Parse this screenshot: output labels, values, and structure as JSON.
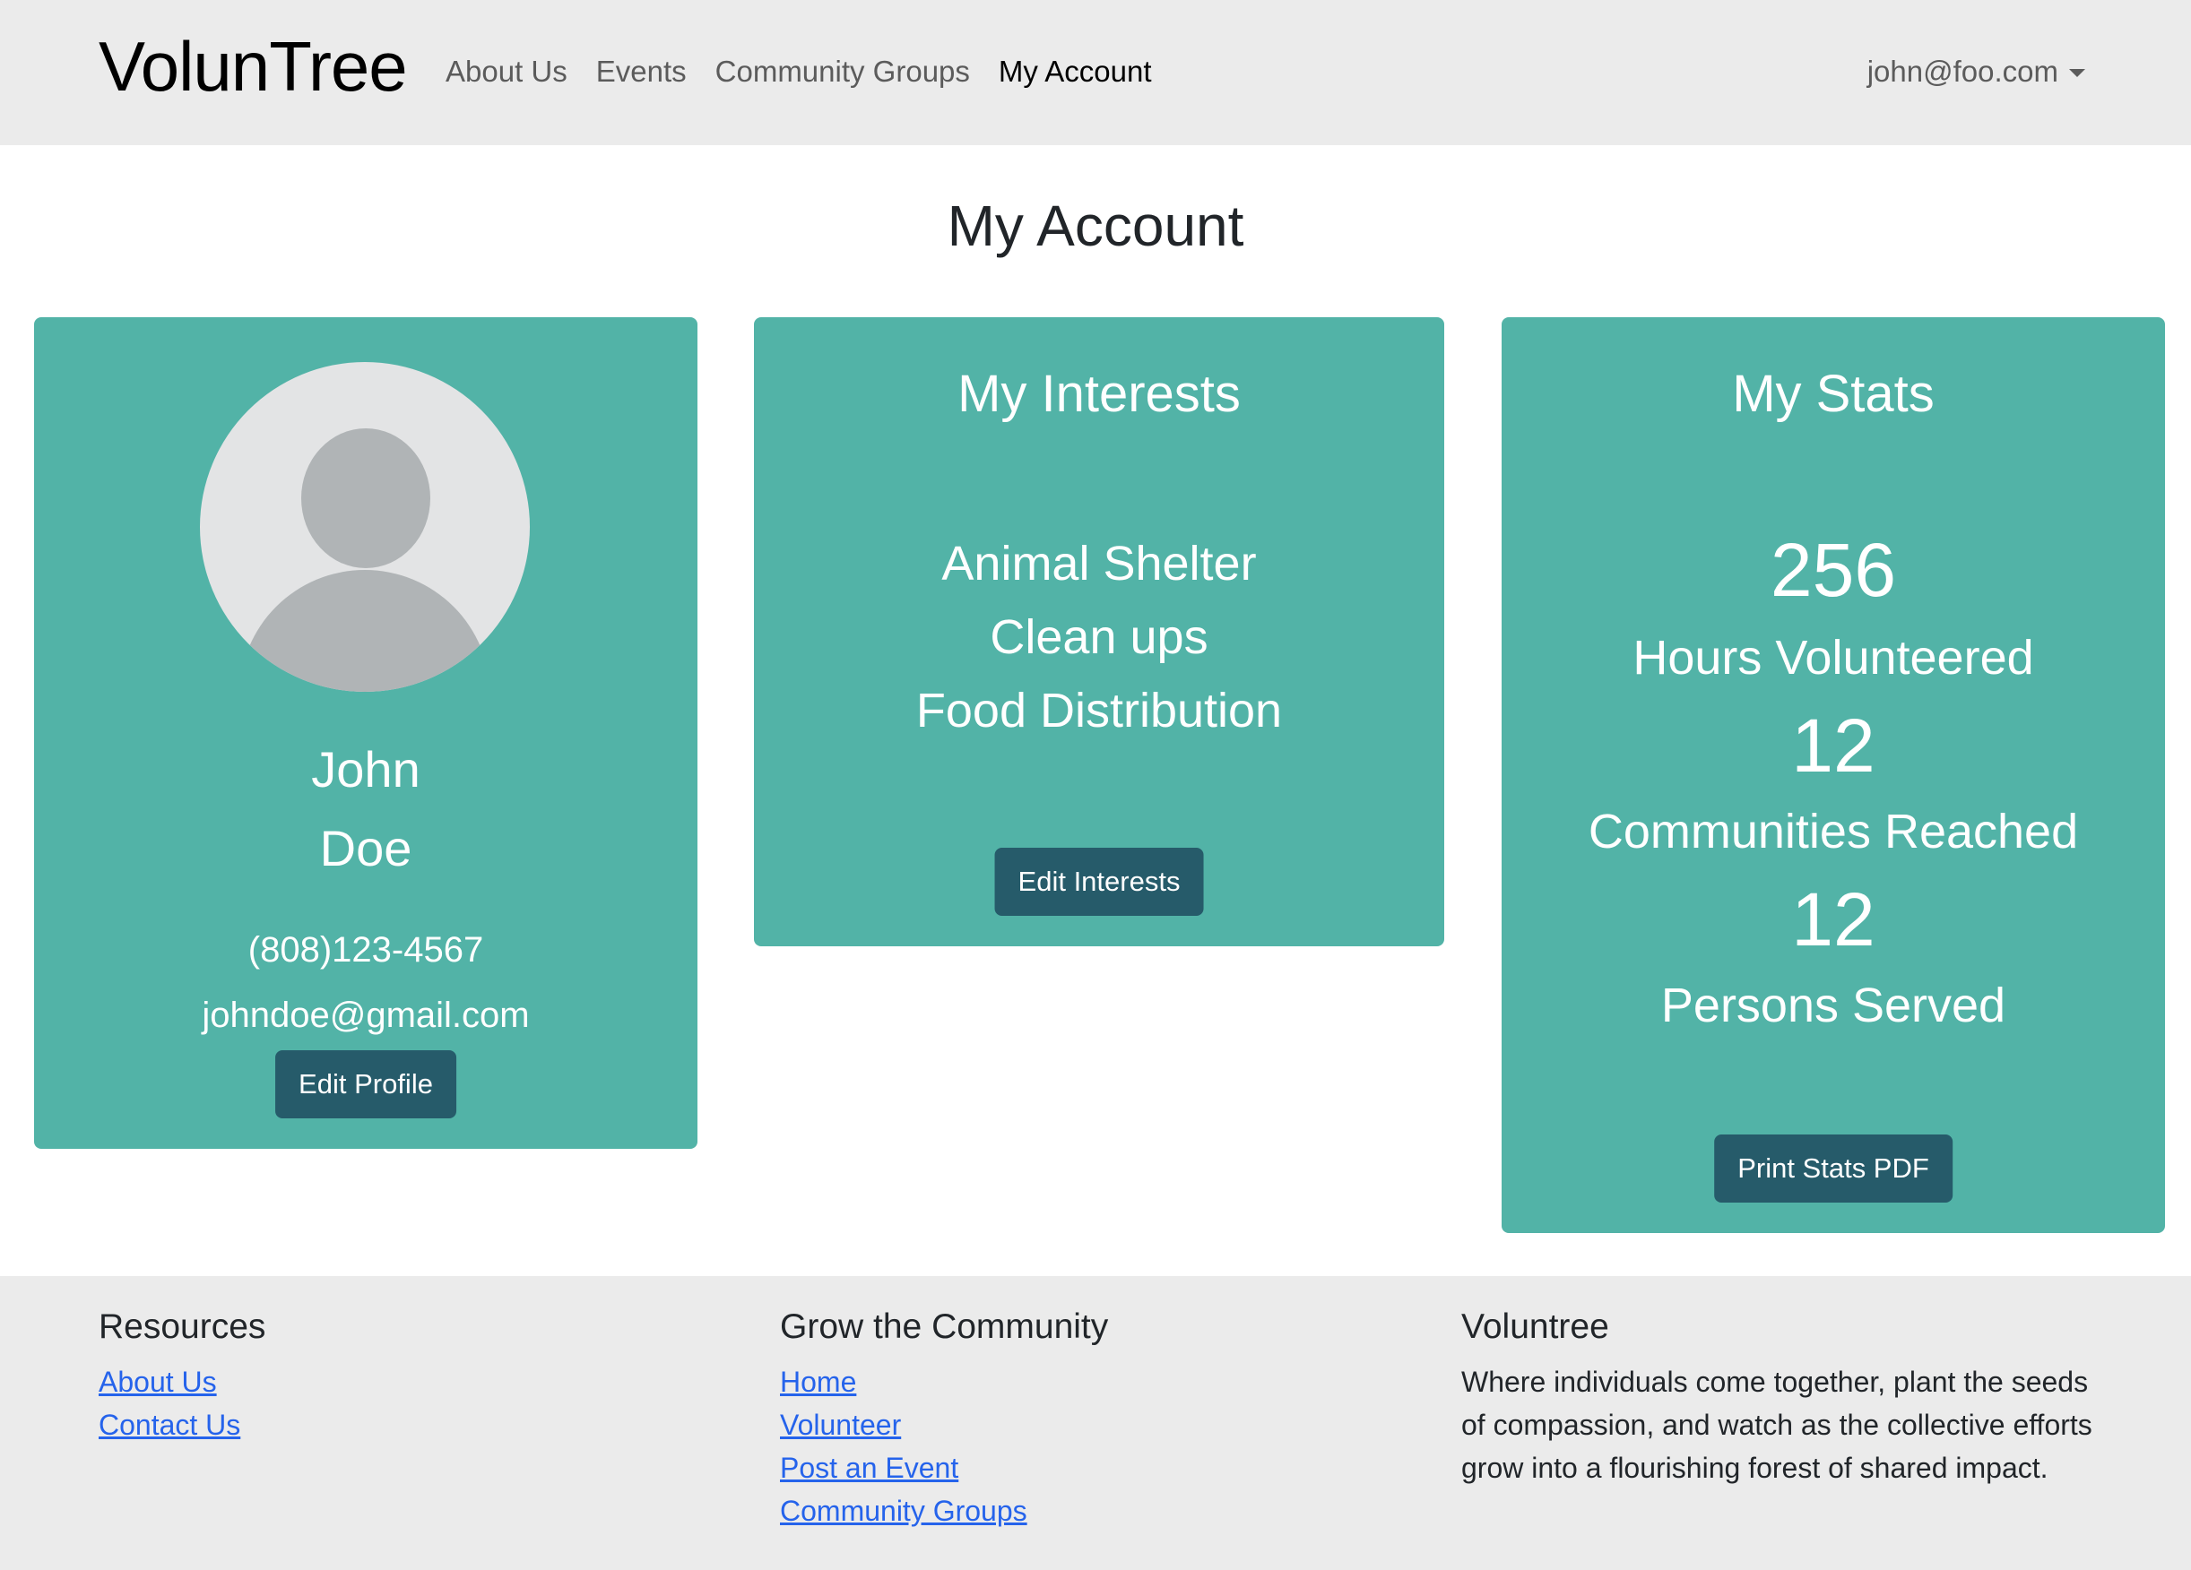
{
  "navbar": {
    "brand": "VolunTree",
    "links": [
      "About Us",
      "Events",
      "Community Groups",
      "My Account"
    ],
    "active_link": "My Account",
    "user_email": "john@foo.com"
  },
  "page": {
    "title": "My Account"
  },
  "profile": {
    "first_name": "John",
    "last_name": "Doe",
    "phone": "(808)123-4567",
    "email": "johndoe@gmail.com",
    "edit_button": "Edit Profile"
  },
  "interests": {
    "title": "My Interests",
    "items": [
      "Animal Shelter",
      "Clean ups",
      "Food Distribution"
    ],
    "edit_button": "Edit Interests"
  },
  "stats": {
    "title": "My Stats",
    "items": [
      {
        "value": "256",
        "label": "Hours Volunteered"
      },
      {
        "value": "12",
        "label": "Communities Reached"
      },
      {
        "value": "12",
        "label": "Persons Served"
      }
    ],
    "print_button": "Print Stats PDF"
  },
  "footer": {
    "resources": {
      "heading": "Resources",
      "links": [
        "About Us",
        "Contact Us"
      ]
    },
    "grow": {
      "heading": "Grow the Community",
      "links": [
        "Home",
        "Volunteer",
        "Post an Event",
        "Community Groups"
      ]
    },
    "about": {
      "heading": "Voluntree",
      "text": "Where individuals come together, plant the seeds of compassion, and watch as the collective efforts grow into a flourishing forest of shared impact."
    }
  },
  "colors": {
    "card": "#52b3a7",
    "button": "#265b6a",
    "navbar": "#ebebeb",
    "link": "#2563eb"
  }
}
